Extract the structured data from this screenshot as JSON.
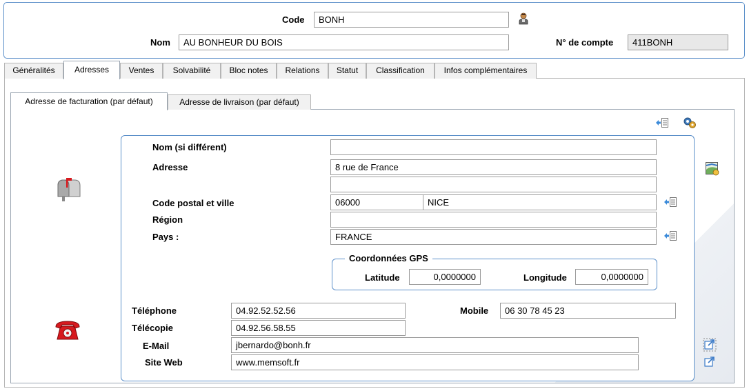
{
  "header": {
    "code_label": "Code",
    "code_value": "BONH",
    "nom_label": "Nom",
    "nom_value": "AU BONHEUR DU BOIS",
    "compte_label": "N° de compte",
    "compte_value": "411BONH"
  },
  "tabs": [
    {
      "label": "Généralités",
      "active": false
    },
    {
      "label": "Adresses",
      "active": true
    },
    {
      "label": "Ventes",
      "active": false
    },
    {
      "label": "Solvabilité",
      "active": false
    },
    {
      "label": "Bloc notes",
      "active": false
    },
    {
      "label": "Relations",
      "active": false
    },
    {
      "label": "Statut",
      "active": false
    },
    {
      "label": "Classification",
      "active": false
    },
    {
      "label": "Infos complémentaires",
      "active": false
    }
  ],
  "subtabs": [
    {
      "label": "Adresse de facturation (par défaut)",
      "active": true
    },
    {
      "label": "Adresse de livraison (par défaut)",
      "active": false
    }
  ],
  "address": {
    "nom_label": "Nom (si différent)",
    "nom_value": "",
    "adresse_label": "Adresse",
    "adresse_line1": "8 rue de France",
    "adresse_line2": "",
    "cp_label": "Code postal et ville",
    "cp_value": "06000",
    "ville_value": "NICE",
    "region_label": "Région",
    "region_value": "",
    "pays_label": "Pays :",
    "pays_value": "FRANCE"
  },
  "gps": {
    "title": "Coordonnées GPS",
    "latitude_label": "Latitude",
    "latitude_value": "0,0000000",
    "longitude_label": "Longitude",
    "longitude_value": "0,0000000"
  },
  "contact": {
    "telephone_label": "Téléphone",
    "telephone_value": "04.92.52.52.56",
    "telecopie_label": "Télécopie",
    "telecopie_value": "04.92.56.58.55",
    "email_label": "E-Mail",
    "email_value": "jbernardo@bonh.fr",
    "site_label": "Site Web",
    "site_value": "www.memsoft.fr",
    "mobile_label": "Mobile",
    "mobile_value": "06 30 78 45 23"
  },
  "icons": {
    "user": "user-icon",
    "mailbox": "mailbox-icon",
    "phone": "phone-icon",
    "lookup": "lookup-list-icon",
    "settings": "gear-icon",
    "map": "map-icon",
    "open_link": "open-link-icon"
  },
  "colors": {
    "accent_border": "#5b8fc9",
    "readonly_bg": "#e8e8e8",
    "phone_red": "#d7191e"
  }
}
